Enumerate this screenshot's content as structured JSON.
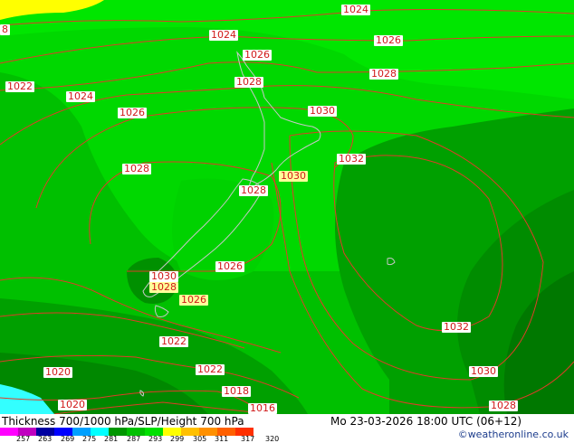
{
  "map": {
    "isobar_labels": [
      {
        "text": "1024",
        "yellow": false
      },
      {
        "text": "1024",
        "yellow": false
      },
      {
        "text": "1026",
        "yellow": false
      },
      {
        "text": "1026",
        "yellow": false
      },
      {
        "text": "1028",
        "yellow": false
      },
      {
        "text": "1028",
        "yellow": false
      },
      {
        "text": "1022",
        "yellow": false
      },
      {
        "text": "1024",
        "yellow": false
      },
      {
        "text": "1026",
        "yellow": false
      },
      {
        "text": "1030",
        "yellow": false
      },
      {
        "text": "1032",
        "yellow": false
      },
      {
        "text": "1028",
        "yellow": false
      },
      {
        "text": "1030",
        "yellow": true
      },
      {
        "text": "1028",
        "yellow": false
      },
      {
        "text": "1026",
        "yellow": false
      },
      {
        "text": "1030",
        "yellow": false
      },
      {
        "text": "1028",
        "yellow": true
      },
      {
        "text": "1026",
        "yellow": true
      },
      {
        "text": "1022",
        "yellow": false
      },
      {
        "text": "1020",
        "yellow": false
      },
      {
        "text": "1022",
        "yellow": false
      },
      {
        "text": "1018",
        "yellow": false
      },
      {
        "text": "1020",
        "yellow": false
      },
      {
        "text": "1016",
        "yellow": false
      },
      {
        "text": "1032",
        "yellow": false
      },
      {
        "text": "1030",
        "yellow": false
      },
      {
        "text": "1028",
        "yellow": false
      },
      {
        "text": "8",
        "yellow": false
      }
    ],
    "colors": {
      "contour": "#e03c28",
      "coast": "#c8c8c8",
      "light_green": "#00d800",
      "green": "#00c000",
      "dark_green": "#009600",
      "darker_green": "#008200",
      "cyan": "#33ffff",
      "yellow": "#ffff00"
    }
  },
  "footer": {
    "title": "Thickness 700/1000 hPa/SLP/Height 700 hPa",
    "datetime": "Mo 23-03-2026 18:00 UTC (06+12)",
    "credit": "©weatheronline.co.uk",
    "scale_ticks": [
      "257",
      "263",
      "269",
      "275",
      "281",
      "287",
      "293",
      "299",
      "305",
      "311",
      "317",
      "320"
    ],
    "scale_colors": [
      "#ff00ff",
      "#c000c0",
      "#0000a0",
      "#0000ff",
      "#00a0ff",
      "#00ffff",
      "#009600",
      "#00c000",
      "#00e000",
      "#ffff00",
      "#ffc000",
      "#ff9000",
      "#ff6000",
      "#ff3000"
    ]
  }
}
